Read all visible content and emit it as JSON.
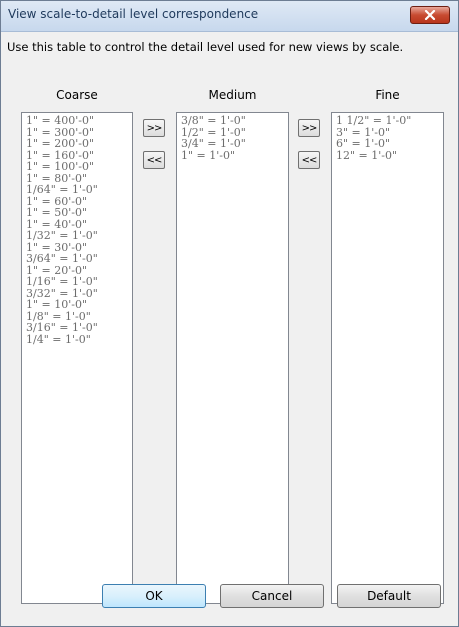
{
  "window": {
    "title": "View scale-to-detail level correspondence"
  },
  "instructions": "Use this table to control the detail level used for new views by scale.",
  "columns": {
    "coarse": {
      "label": "Coarse",
      "items": [
        "1\" = 400'-0\"",
        "1\" = 300'-0\"",
        "1\" = 200'-0\"",
        "1\" = 160'-0\"",
        "1\" = 100'-0\"",
        "1\" = 80'-0\"",
        "1/64\" = 1'-0\"",
        "1\" = 60'-0\"",
        "1\" = 50'-0\"",
        "1\" = 40'-0\"",
        "1/32\" = 1'-0\"",
        "1\" = 30'-0\"",
        "3/64\" = 1'-0\"",
        "1\" = 20'-0\"",
        "1/16\" = 1'-0\"",
        "3/32\" = 1'-0\"",
        "1\" = 10'-0\"",
        "1/8\" = 1'-0\"",
        "3/16\" = 1'-0\"",
        "1/4\" = 1'-0\""
      ]
    },
    "medium": {
      "label": "Medium",
      "items": [
        "3/8\" = 1'-0\"",
        "1/2\" = 1'-0\"",
        "3/4\" = 1'-0\"",
        "1\" = 1'-0\""
      ]
    },
    "fine": {
      "label": "Fine",
      "items": [
        "1 1/2\" = 1'-0\"",
        "3\" = 1'-0\"",
        "6\" = 1'-0\"",
        "12\" = 1'-0\""
      ]
    }
  },
  "move_buttons": {
    "coarse_to_medium": ">>",
    "medium_to_coarse": "<<",
    "medium_to_fine": ">>",
    "fine_to_medium": "<<"
  },
  "buttons": {
    "ok": "OK",
    "cancel": "Cancel",
    "default": "Default"
  },
  "icons": {
    "close": "close-icon"
  }
}
